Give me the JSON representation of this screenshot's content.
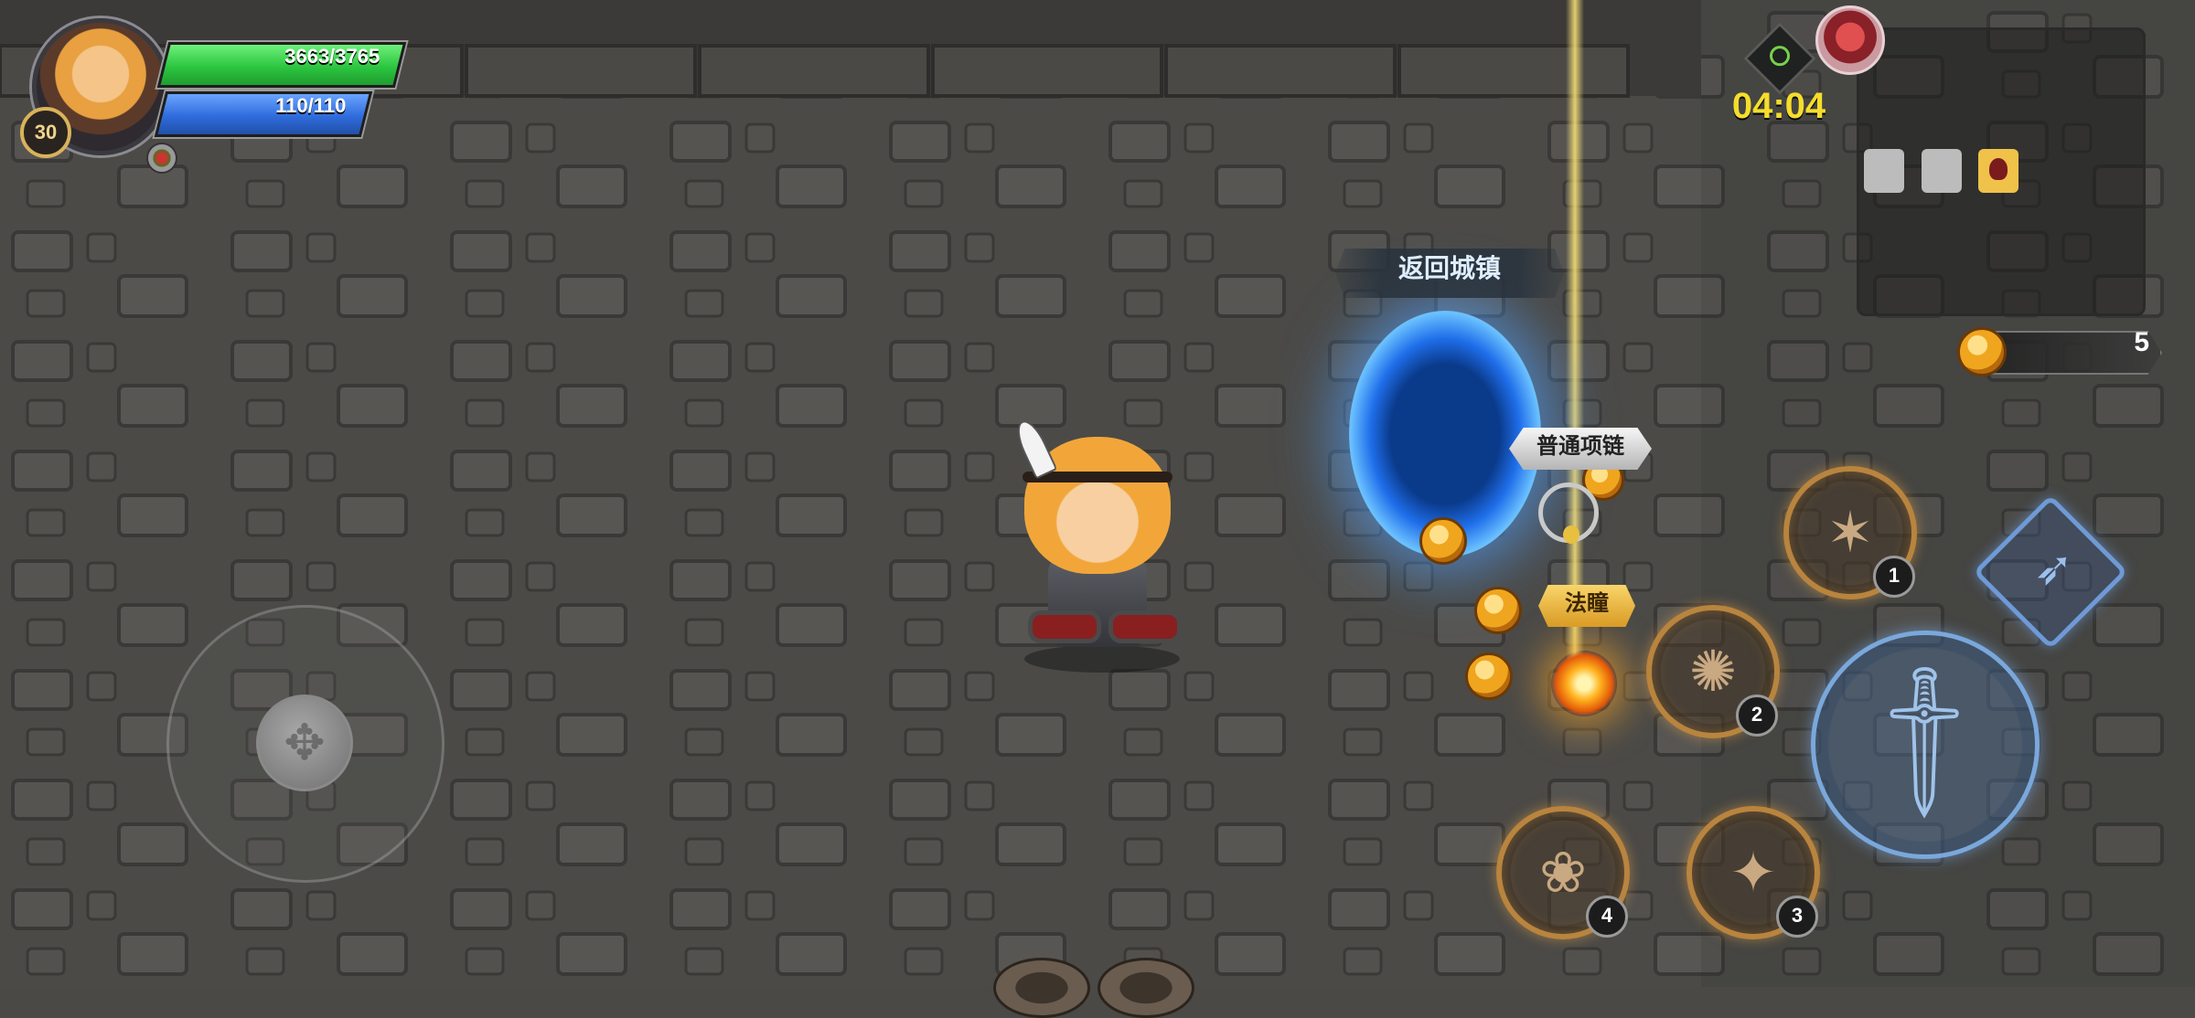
{
  "player": {
    "level": "30",
    "hp": "3663/3765",
    "hp_fraction": 0.972,
    "mp": "110/110",
    "mp_fraction": 1.0
  },
  "timer": "04:04",
  "coins": "5",
  "portal_label": "返回城镇",
  "drops": [
    {
      "name": "普通项链",
      "rarity": "common"
    },
    {
      "name": "法瞳",
      "rarity": "gold"
    }
  ],
  "skills": [
    {
      "slot": "1",
      "icon": "crossbow-volley-icon"
    },
    {
      "slot": "2",
      "icon": "spin-slash-icon"
    },
    {
      "slot": "3",
      "icon": "flying-kick-icon"
    },
    {
      "slot": "4",
      "icon": "fairy-summon-icon"
    }
  ],
  "colors": {
    "hp": "#2cc640",
    "mp": "#2f6cdc",
    "timer": "#f5dd2c",
    "skill_ring": "#b9843e",
    "attack_ring": "#7aa8dc"
  }
}
